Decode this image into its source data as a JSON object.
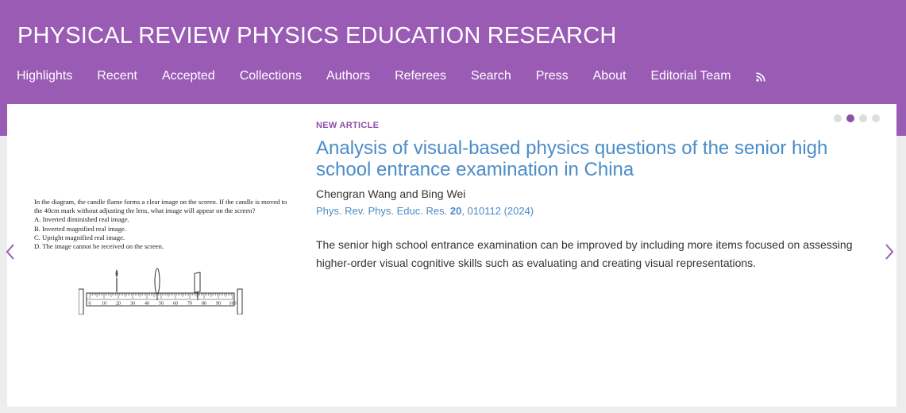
{
  "header": {
    "title": "PHYSICAL REVIEW PHYSICS EDUCATION RESEARCH",
    "nav": [
      "Highlights",
      "Recent",
      "Accepted",
      "Collections",
      "Authors",
      "Referees",
      "Search",
      "Press",
      "About",
      "Editorial Team"
    ],
    "rss_icon": "rss-icon"
  },
  "featured": {
    "label": "NEW ARTICLE",
    "title": "Analysis of visual-based physics questions of the senior high school entrance examination in China",
    "authors": "Chengran Wang and Bing Wei",
    "citation_journal": "Phys. Rev. Phys. Educ. Res.",
    "citation_volume": "20",
    "citation_rest": ", 010112 (2024)",
    "abstract": "The senior high school entrance examination can be improved by including more items focused on assessing higher-order visual cognitive skills such as evaluating and creating visual representations.",
    "figure": {
      "question": "In the diagram, the candle flame forms a clear image on the screen. If the candle is moved to the 40cm mark without adjusting the lens, what image will appear on the screen?",
      "options": [
        "A. Inverted diminished real image.",
        "B. Inverted magnified real image.",
        "C. Upright magnified real image.",
        "D. The image cannot be received on the screen."
      ],
      "ruler_labels": [
        "0",
        "10",
        "20",
        "30",
        "40",
        "50",
        "60",
        "70",
        "80",
        "90",
        "100"
      ]
    }
  },
  "carousel": {
    "slide_count": 4,
    "active_index": 1,
    "accent_color": "#8d4fa8"
  },
  "colors": {
    "header_bg": "#9a5bb5",
    "link": "#4a8cc9"
  }
}
